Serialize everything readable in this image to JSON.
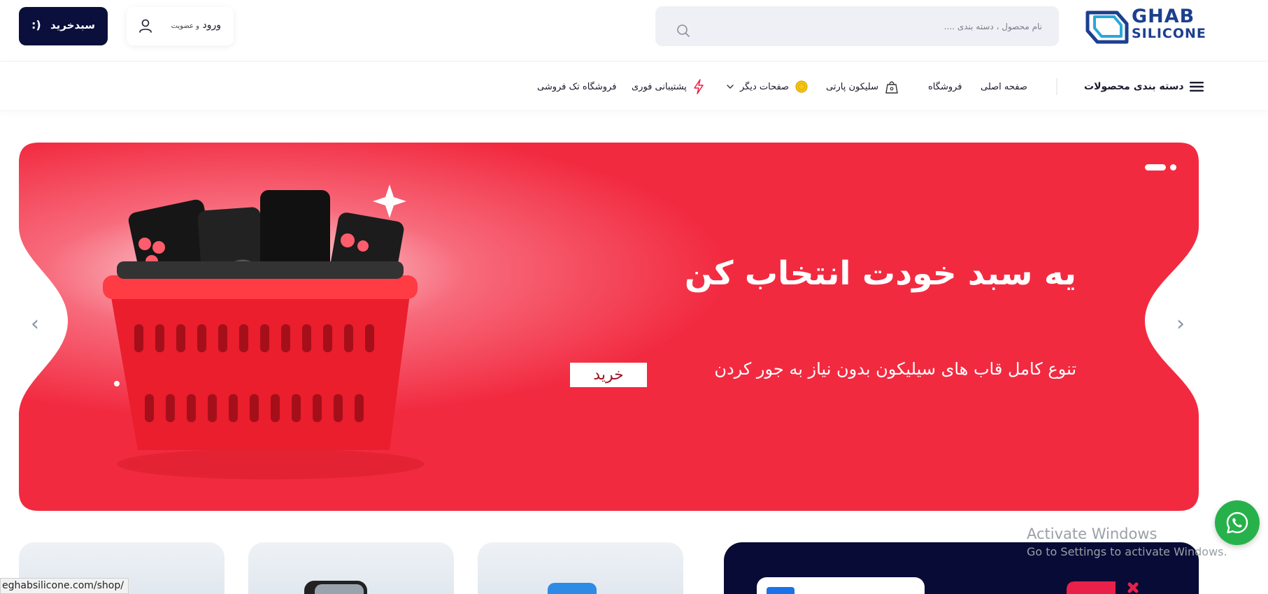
{
  "brand": {
    "line1": "GHAB",
    "line2": "SILICONE",
    "primary_color": "#1c3f8f",
    "accent_color": "#2aa8d6"
  },
  "header": {
    "search_placeholder": "نام محصول ، دسته بندی ....",
    "search_icon": "search-icon",
    "login_label": "ورود",
    "login_small": "و عضویت",
    "user_icon": "user-icon",
    "cart_label": "سبدخرید",
    "cart_icon": ":)",
    "cart_color": "#0a0f3c"
  },
  "nav": {
    "categories_label": "دسته بندی محصولات",
    "items": [
      {
        "label": "صفحه اصلی"
      },
      {
        "label": "فروشگاه"
      },
      {
        "label": "سلیکون پارتی",
        "icon": "bag-icon"
      },
      {
        "label": "صفحات دیگر",
        "icon": "coin-icon",
        "dropdown": true
      },
      {
        "label": "پشتیبانی فوری",
        "icon": "lightning-icon"
      },
      {
        "label": "فروشگاه تک فروشی"
      }
    ]
  },
  "slider": {
    "title": "یه سبد خودت انتخاب کن",
    "subtitle": "تنوع کامل قاب های سیلیکون بدون نیاز به جور کردن",
    "button_label": "خرید",
    "background_color": "#f22a40",
    "prev_icon": "chevron-left-icon",
    "next_icon": "chevron-right-icon",
    "active_slide": 1,
    "slide_count": 2
  },
  "status_bar": {
    "url": "eghabsilicone.com/shop/"
  },
  "watermark": {
    "title": "Activate Windows",
    "subtitle": "Go to Settings to activate Windows."
  },
  "whatsapp": {
    "icon": "whatsapp-icon",
    "color": "#27b14a"
  }
}
